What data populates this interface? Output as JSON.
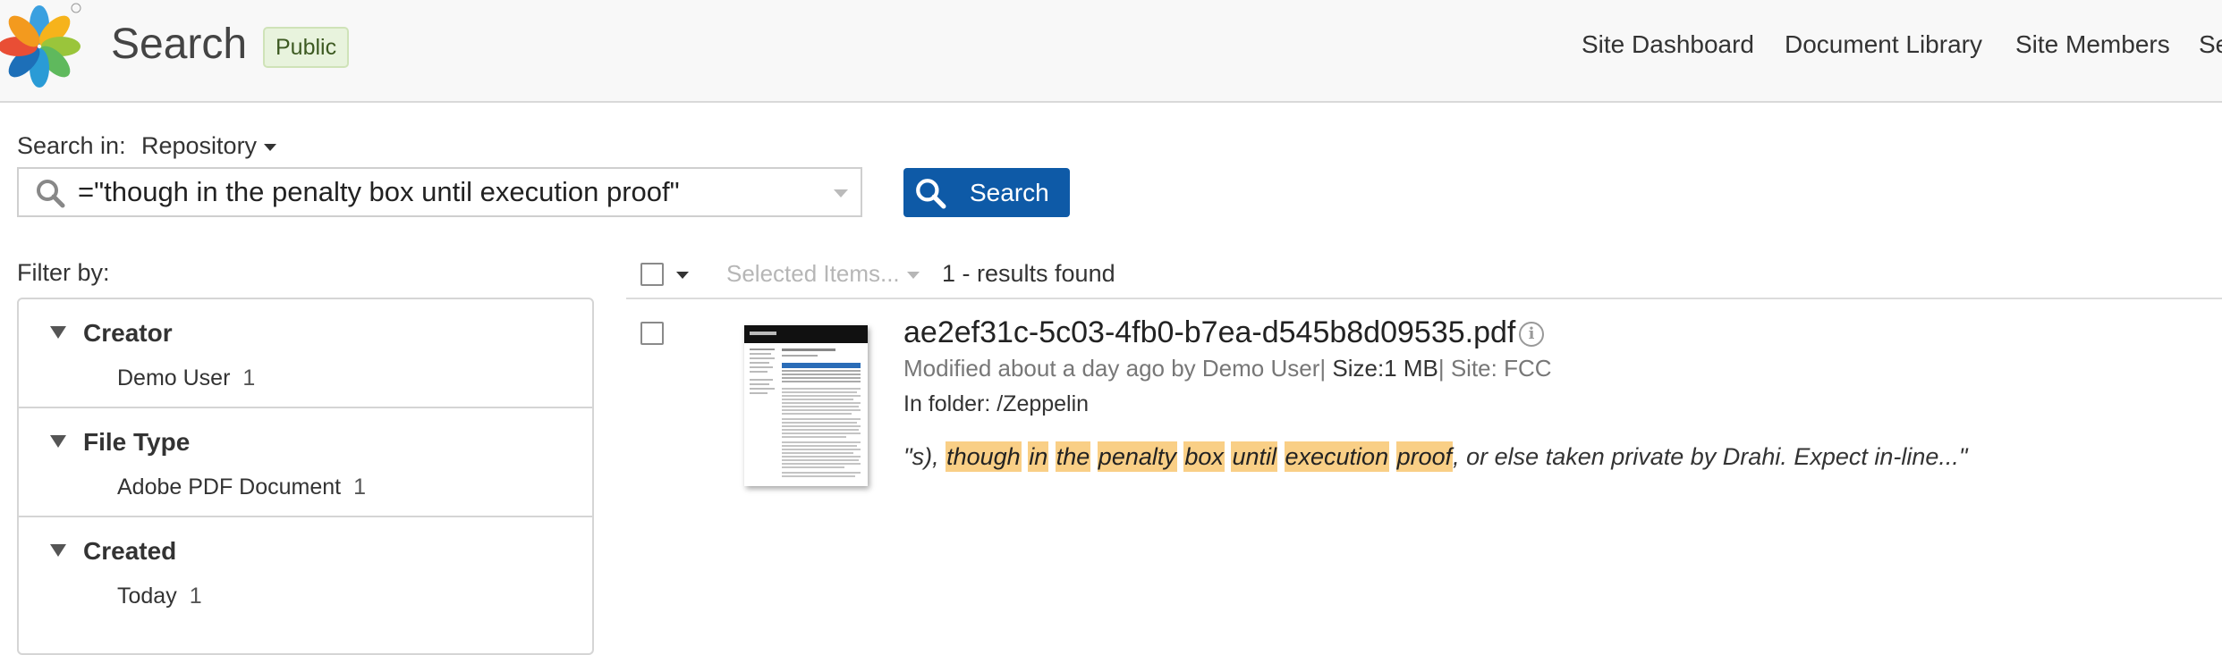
{
  "header": {
    "title": "Search",
    "badge": "Public",
    "nav": [
      "Site Dashboard",
      "Document Library",
      "Site Members",
      "Se"
    ]
  },
  "search": {
    "search_in_label": "Search in:",
    "search_in_value": "Repository",
    "query": "=\"though in the penalty box until execution proof\"",
    "button_label": "Search"
  },
  "filter": {
    "label": "Filter by:",
    "facets": [
      {
        "title": "Creator",
        "items": [
          {
            "label": "Demo User",
            "count": "1"
          }
        ]
      },
      {
        "title": "File Type",
        "items": [
          {
            "label": "Adobe PDF Document",
            "count": "1"
          }
        ]
      },
      {
        "title": "Created",
        "items": [
          {
            "label": "Today",
            "count": "1"
          }
        ]
      }
    ]
  },
  "results": {
    "selected_items": "Selected Items...",
    "count_text": "1 - results found",
    "items": [
      {
        "name": "ae2ef31c-5c03-4fb0-b7ea-d545b8d09535.pdf",
        "modified": "Modified about a day ago by Demo User",
        "size_label": "Size:",
        "size": "1 MB",
        "site": "Site: FCC",
        "folder": "In folder: /Zeppelin",
        "snippet_prefix": "\"s), ",
        "snippet_terms": [
          "though",
          "in",
          "the",
          "penalty",
          "box",
          "until",
          "execution",
          "proof"
        ],
        "snippet_suffix": ", or else taken private by Drahi. Expect in-line...\""
      }
    ]
  },
  "colors": {
    "accent": "#0e5aa7",
    "highlight": "#f9cf86",
    "badge_bg": "#e8f3dd"
  },
  "icons": [
    "alfresco-logo-icon",
    "search-icon",
    "chevron-down-icon",
    "checkbox-icon",
    "info-icon",
    "document-thumbnail"
  ]
}
